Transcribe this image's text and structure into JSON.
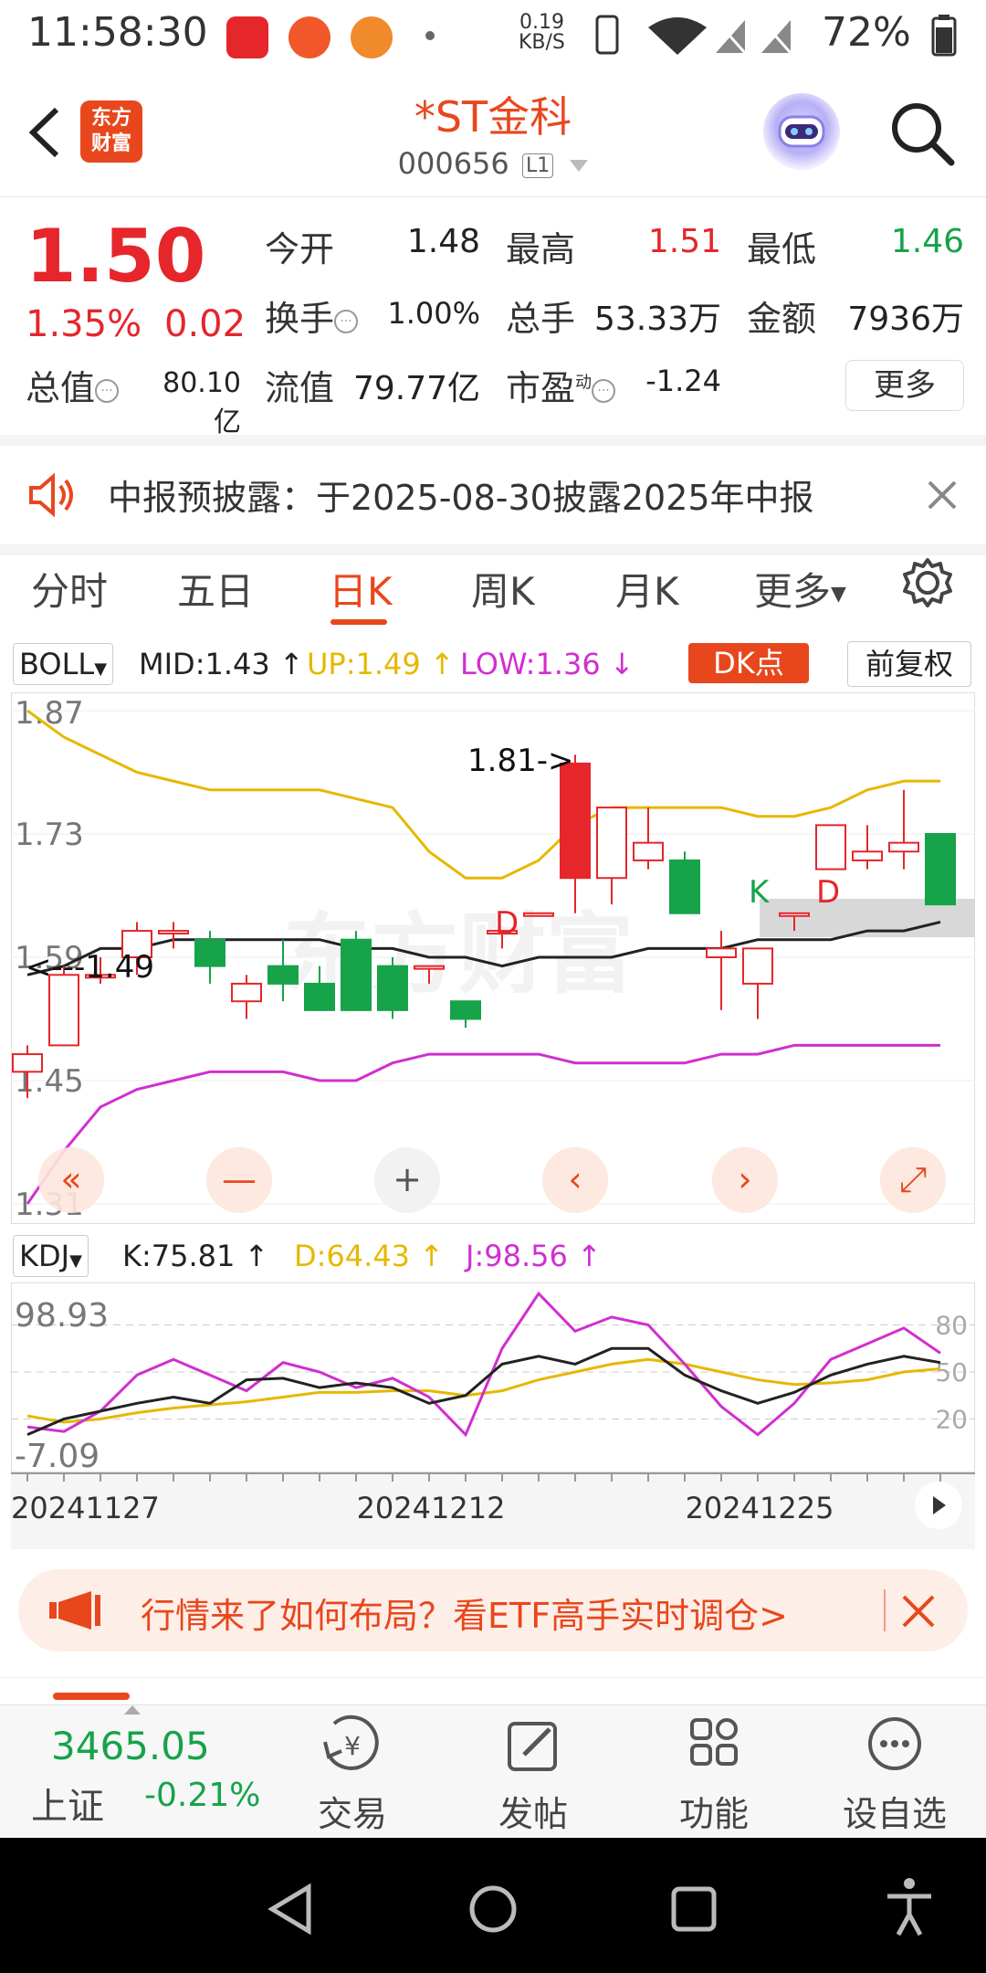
{
  "status_bar": {
    "time": "11:58:30",
    "net_speed": "0.19",
    "net_unit": "KB/S",
    "battery": "72%",
    "app_icons": [
      "toutiao-icon",
      "app-red-icon",
      "app-orange-icon"
    ]
  },
  "header": {
    "name": "*ST金科",
    "code": "000656",
    "badge": "L1",
    "brand_line1": "东方",
    "brand_line2": "财富"
  },
  "quote": {
    "price": "1.50",
    "pct": "1.35%",
    "change": "0.02",
    "open_label": "今开",
    "open": "1.48",
    "high_label": "最高",
    "high": "1.51",
    "low_label": "最低",
    "low": "1.46",
    "turnover_label": "换手",
    "turnover": "1.00%",
    "volume_label": "总手",
    "volume": "53.33万",
    "amount_label": "金额",
    "amount": "7936万",
    "mktcap_label": "总值",
    "mktcap": "80.10亿",
    "float_label": "流值",
    "float": "79.77亿",
    "pe_label": "市盈",
    "pe_sup": "动",
    "pe": "-1.24",
    "more": "更多",
    "colors": {
      "up": "#e5262b",
      "down": "#16a34a"
    }
  },
  "notice": {
    "text": "中报预披露：于2025-08-30披露2025年中报"
  },
  "tabs": [
    {
      "label": "分时"
    },
    {
      "label": "五日"
    },
    {
      "label": "日K"
    },
    {
      "label": "周K"
    },
    {
      "label": "月K"
    },
    {
      "label": "更多"
    }
  ],
  "indicator": {
    "name": "BOLL",
    "mid": "MID:1.43",
    "up": "UP:1.49",
    "low": "LOW:1.36",
    "dk": "DK点",
    "fq": "前复权"
  },
  "kline": {
    "y_ticks": [
      "1.87",
      "1.73",
      "1.59",
      "1.45",
      "1.31"
    ],
    "annotation_high": "1.81->",
    "annotation_low": "<---1.49",
    "markers": [
      "D",
      "K",
      "D"
    ],
    "watermark": "东方财富"
  },
  "kdj": {
    "name": "KDJ",
    "k": "K:75.81",
    "d": "D:64.43",
    "j": "J:98.56",
    "y_top": "98.93",
    "y_bottom": "-7.09",
    "levels": [
      "80",
      "50",
      "20"
    ]
  },
  "xaxis": {
    "dates": [
      "20241127",
      "20241212",
      "20241225"
    ]
  },
  "ad": {
    "text": "行情来了如何布局？看ETF高手实时调仓>"
  },
  "bottom": {
    "index_value": "3465.05",
    "index_name": "上证",
    "index_pct": "-0.21%",
    "items": [
      {
        "label": "交易"
      },
      {
        "label": "发帖"
      },
      {
        "label": "功能"
      },
      {
        "label": "设自选"
      }
    ]
  },
  "chart_data": {
    "type": "candlestick",
    "candles": [
      {
        "o": 1.46,
        "c": 1.48,
        "h": 1.49,
        "l": 1.43
      },
      {
        "o": 1.49,
        "c": 1.57,
        "h": 1.58,
        "l": 1.49
      },
      {
        "o": 1.57,
        "c": 1.57,
        "h": 1.59,
        "l": 1.56
      },
      {
        "o": 1.59,
        "c": 1.62,
        "h": 1.63,
        "l": 1.57
      },
      {
        "o": 1.62,
        "c": 1.62,
        "h": 1.63,
        "l": 1.6
      },
      {
        "o": 1.61,
        "c": 1.58,
        "h": 1.62,
        "l": 1.56
      },
      {
        "o": 1.54,
        "c": 1.56,
        "h": 1.57,
        "l": 1.52
      },
      {
        "o": 1.58,
        "c": 1.56,
        "h": 1.61,
        "l": 1.54
      },
      {
        "o": 1.56,
        "c": 1.53,
        "h": 1.58,
        "l": 1.53
      },
      {
        "o": 1.61,
        "c": 1.53,
        "h": 1.62,
        "l": 1.53
      },
      {
        "o": 1.58,
        "c": 1.53,
        "h": 1.59,
        "l": 1.52
      },
      {
        "o": 1.58,
        "c": 1.58,
        "h": 1.58,
        "l": 1.56
      },
      {
        "o": 1.54,
        "c": 1.52,
        "h": 1.54,
        "l": 1.51
      },
      {
        "o": 1.62,
        "c": 1.62,
        "h": 1.62,
        "l": 1.6
      },
      {
        "o": 1.64,
        "c": 1.64,
        "h": 1.64,
        "l": 1.64
      },
      {
        "o": 1.68,
        "c": 1.81,
        "h": 1.82,
        "l": 1.64
      },
      {
        "o": 1.68,
        "c": 1.76,
        "h": 1.76,
        "l": 1.65
      },
      {
        "o": 1.7,
        "c": 1.72,
        "h": 1.76,
        "l": 1.69
      },
      {
        "o": 1.7,
        "c": 1.64,
        "h": 1.71,
        "l": 1.64
      },
      {
        "o": 1.59,
        "c": 1.6,
        "h": 1.62,
        "l": 1.53
      },
      {
        "o": 1.56,
        "c": 1.6,
        "h": 1.6,
        "l": 1.52
      },
      {
        "o": 1.64,
        "c": 1.64,
        "h": 1.64,
        "l": 1.62
      },
      {
        "o": 1.69,
        "c": 1.74,
        "h": 1.74,
        "l": 1.69
      },
      {
        "o": 1.7,
        "c": 1.71,
        "h": 1.74,
        "l": 1.69
      },
      {
        "o": 1.71,
        "c": 1.72,
        "h": 1.78,
        "l": 1.69
      },
      {
        "o": 1.73,
        "c": 1.65,
        "h": 1.73,
        "l": 1.65
      }
    ],
    "boll_mid": [
      1.57,
      1.58,
      1.6,
      1.6,
      1.61,
      1.61,
      1.61,
      1.61,
      1.61,
      1.6,
      1.6,
      1.59,
      1.59,
      1.58,
      1.59,
      1.59,
      1.59,
      1.6,
      1.6,
      1.6,
      1.61,
      1.61,
      1.61,
      1.62,
      1.62,
      1.63
    ],
    "boll_up": [
      1.87,
      1.84,
      1.82,
      1.8,
      1.79,
      1.78,
      1.78,
      1.78,
      1.78,
      1.77,
      1.76,
      1.71,
      1.68,
      1.68,
      1.7,
      1.74,
      1.76,
      1.76,
      1.76,
      1.76,
      1.75,
      1.75,
      1.76,
      1.78,
      1.79,
      1.79
    ],
    "boll_low": [
      1.31,
      1.37,
      1.42,
      1.44,
      1.45,
      1.46,
      1.46,
      1.46,
      1.45,
      1.45,
      1.47,
      1.48,
      1.48,
      1.48,
      1.48,
      1.47,
      1.47,
      1.47,
      1.47,
      1.48,
      1.48,
      1.49,
      1.49,
      1.49,
      1.49,
      1.49
    ],
    "kdj_k": [
      10,
      20,
      25,
      30,
      34,
      30,
      45,
      46,
      40,
      43,
      40,
      30,
      35,
      55,
      60,
      55,
      65,
      65,
      48,
      38,
      30,
      37,
      48,
      55,
      60,
      56
    ],
    "kdj_d": [
      22,
      18,
      20,
      24,
      27,
      29,
      31,
      34,
      37,
      37,
      38,
      38,
      35,
      38,
      45,
      50,
      55,
      58,
      55,
      50,
      45,
      42,
      43,
      45,
      50,
      52
    ],
    "kdj_j": [
      15,
      12,
      25,
      48,
      58,
      48,
      38,
      56,
      50,
      40,
      46,
      34,
      10,
      65,
      100,
      76,
      85,
      80,
      55,
      28,
      10,
      30,
      58,
      68,
      78,
      62
    ],
    "kdj_ylim": [
      -7.09,
      98.93
    ],
    "ylim": [
      1.31,
      1.87
    ],
    "x_labels": [
      "20241127",
      "20241212",
      "20241225"
    ]
  }
}
